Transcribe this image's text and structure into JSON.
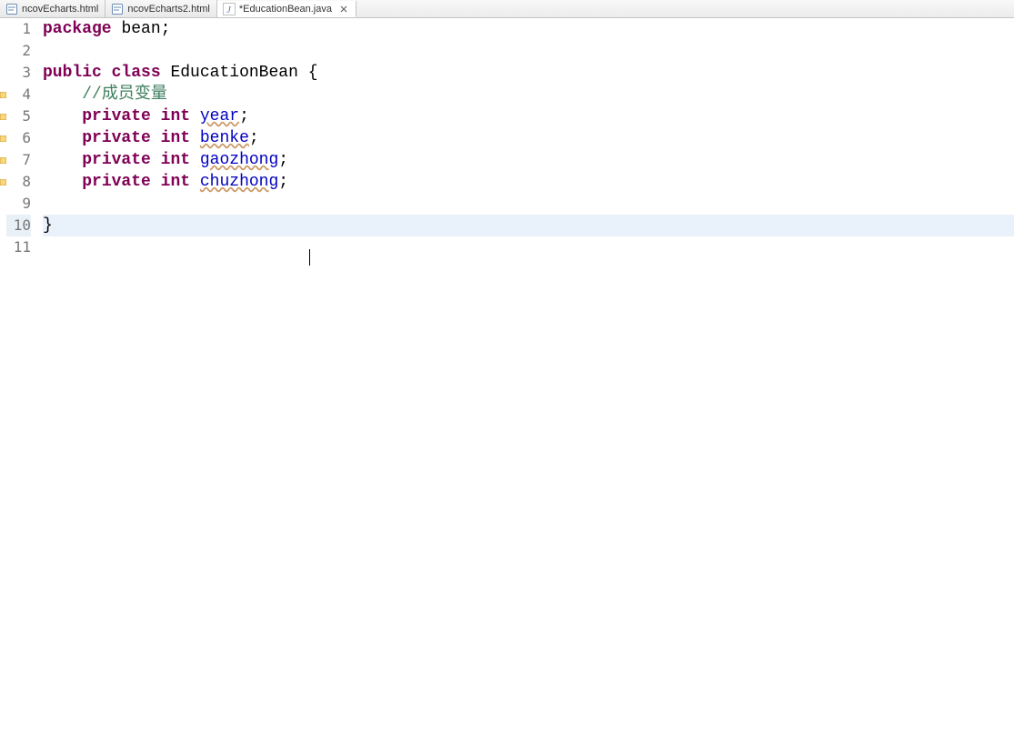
{
  "tabs": [
    {
      "label": "ncovEcharts.html",
      "type": "html",
      "active": false,
      "closeable": false
    },
    {
      "label": "ncovEcharts2.html",
      "type": "html",
      "active": false,
      "closeable": false
    },
    {
      "label": "*EducationBean.java",
      "type": "java",
      "active": true,
      "closeable": true
    }
  ],
  "highlighted_line": 10,
  "warning_lines": [
    4,
    5,
    6,
    7,
    8
  ],
  "cursor": {
    "line": 11,
    "col": 27
  },
  "code_lines": [
    {
      "n": 1,
      "tokens": [
        [
          "kw",
          "package"
        ],
        [
          "punct",
          " "
        ],
        [
          "pkg",
          "bean"
        ],
        [
          "punct",
          ";"
        ]
      ]
    },
    {
      "n": 2,
      "tokens": []
    },
    {
      "n": 3,
      "tokens": [
        [
          "kw",
          "public"
        ],
        [
          "punct",
          " "
        ],
        [
          "kw",
          "class"
        ],
        [
          "punct",
          " "
        ],
        [
          "cls",
          "EducationBean"
        ],
        [
          "punct",
          " {"
        ]
      ]
    },
    {
      "n": 4,
      "tokens": [
        [
          "punct",
          "    "
        ],
        [
          "cmt",
          "//成员变量"
        ]
      ]
    },
    {
      "n": 5,
      "tokens": [
        [
          "punct",
          "    "
        ],
        [
          "kw",
          "private"
        ],
        [
          "punct",
          " "
        ],
        [
          "kw",
          "int"
        ],
        [
          "punct",
          " "
        ],
        [
          "fld",
          "year"
        ],
        [
          "punct",
          ";"
        ]
      ]
    },
    {
      "n": 6,
      "tokens": [
        [
          "punct",
          "    "
        ],
        [
          "kw",
          "private"
        ],
        [
          "punct",
          " "
        ],
        [
          "kw",
          "int"
        ],
        [
          "punct",
          " "
        ],
        [
          "fld",
          "benke"
        ],
        [
          "punct",
          ";"
        ]
      ]
    },
    {
      "n": 7,
      "tokens": [
        [
          "punct",
          "    "
        ],
        [
          "kw",
          "private"
        ],
        [
          "punct",
          " "
        ],
        [
          "kw",
          "int"
        ],
        [
          "punct",
          " "
        ],
        [
          "fld",
          "gaozhong"
        ],
        [
          "punct",
          ";"
        ]
      ]
    },
    {
      "n": 8,
      "tokens": [
        [
          "punct",
          "    "
        ],
        [
          "kw",
          "private"
        ],
        [
          "punct",
          " "
        ],
        [
          "kw",
          "int"
        ],
        [
          "punct",
          " "
        ],
        [
          "fld",
          "chuzhong"
        ],
        [
          "punct",
          ";"
        ]
      ]
    },
    {
      "n": 9,
      "tokens": []
    },
    {
      "n": 10,
      "tokens": [
        [
          "punct",
          "}"
        ]
      ]
    },
    {
      "n": 11,
      "tokens": []
    }
  ]
}
